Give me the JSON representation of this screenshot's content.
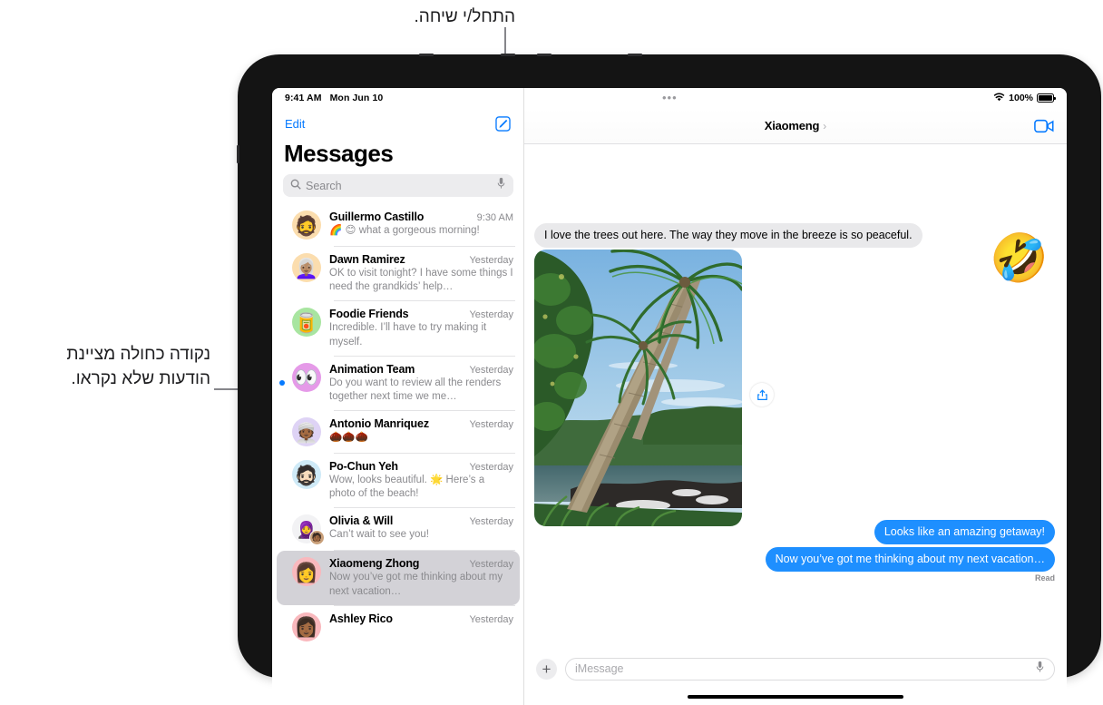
{
  "callouts": [
    {
      "id": "compose-callout",
      "text": "התחל/י שיחה."
    },
    {
      "id": "unread-callout",
      "text": "נקודה כחולה מציינת\nהודעות שלא נקראו."
    }
  ],
  "sidebar": {
    "status_bar": {
      "time": "9:41 AM",
      "date": "Mon Jun 10"
    },
    "edit_label": "Edit",
    "compose_icon": "compose-icon",
    "title": "Messages",
    "search": {
      "placeholder": "Search",
      "icon": "search-icon",
      "mic_icon": "microphone-icon"
    },
    "conversations": [
      {
        "name": "Guillermo Castillo",
        "time": "9:30 AM",
        "preview": "🌈 😊 what a gorgeous morning!",
        "avatar_emoji": "🧔",
        "avatar_bg": "#fbddae",
        "unread": false,
        "selected": false
      },
      {
        "name": "Dawn Ramirez",
        "time": "Yesterday",
        "preview": "OK to visit tonight? I have some things I need the grandkids’ help…",
        "avatar_emoji": "👩🏽‍🦳",
        "avatar_bg": "#fbddae",
        "unread": false,
        "selected": false
      },
      {
        "name": "Foodie Friends",
        "time": "Yesterday",
        "preview": "Incredible. I’ll have to try making it myself.",
        "avatar_emoji": "🥫",
        "avatar_bg": "#a8e5a0",
        "unread": false,
        "selected": false
      },
      {
        "name": "Animation Team",
        "time": "Yesterday",
        "preview": "Do you want to review all the renders together next time we me…",
        "avatar_emoji": "👀",
        "avatar_bg": "#e59ae8",
        "unread": true,
        "selected": false
      },
      {
        "name": "Antonio Manriquez",
        "time": "Yesterday",
        "preview": "🌰🌰🌰",
        "avatar_emoji": "👳🏾",
        "avatar_bg": "#ded3f5",
        "unread": false,
        "selected": false
      },
      {
        "name": "Po-Chun Yeh",
        "time": "Yesterday",
        "preview": "Wow, looks beautiful. 🌟 Here’s a photo of the beach!",
        "avatar_emoji": "🧔🏻",
        "avatar_bg": "#cfeaf7",
        "unread": false,
        "selected": false
      },
      {
        "name": "Olivia & Will",
        "time": "Yesterday",
        "preview": "Can’t wait to see you!",
        "avatar_emoji": "🧕",
        "avatar_bg": "#f2f2f4",
        "badge_emoji": "🧑🏾",
        "unread": false,
        "selected": false
      },
      {
        "name": "Xiaomeng Zhong",
        "time": "Yesterday",
        "preview": "Now you’ve got me thinking about my next vacation…",
        "avatar_emoji": "👩",
        "avatar_bg": "#f9b8bd",
        "unread": false,
        "selected": true
      },
      {
        "name": "Ashley Rico",
        "time": "Yesterday",
        "preview": "",
        "avatar_emoji": "👩🏾",
        "avatar_bg": "#f9b8bd",
        "unread": false,
        "selected": false
      }
    ]
  },
  "conversation": {
    "status_bar": {
      "battery_percent": "100%",
      "wifi_icon": "wifi-icon",
      "battery_icon": "battery-icon"
    },
    "handle_indicator": "•••",
    "title": "Xiaomeng",
    "title_chevron": "›",
    "facetime_icon": "facetime-video-icon",
    "reaction_emoji": "🤣",
    "messages": [
      {
        "side": "in",
        "text": "I love the trees out here. The way they move in the breeze is so peaceful."
      },
      {
        "side": "out",
        "text": "Looks like an amazing getaway!"
      },
      {
        "side": "out",
        "text": "Now you’ve got me thinking about my next vacation…"
      }
    ],
    "read_receipt": "Read",
    "photo_alt": "beach-photo-palm-trees",
    "share_icon": "share-save-icon",
    "composer": {
      "plus_label": "+",
      "placeholder": "iMessage",
      "mic_icon": "microphone-icon"
    }
  }
}
